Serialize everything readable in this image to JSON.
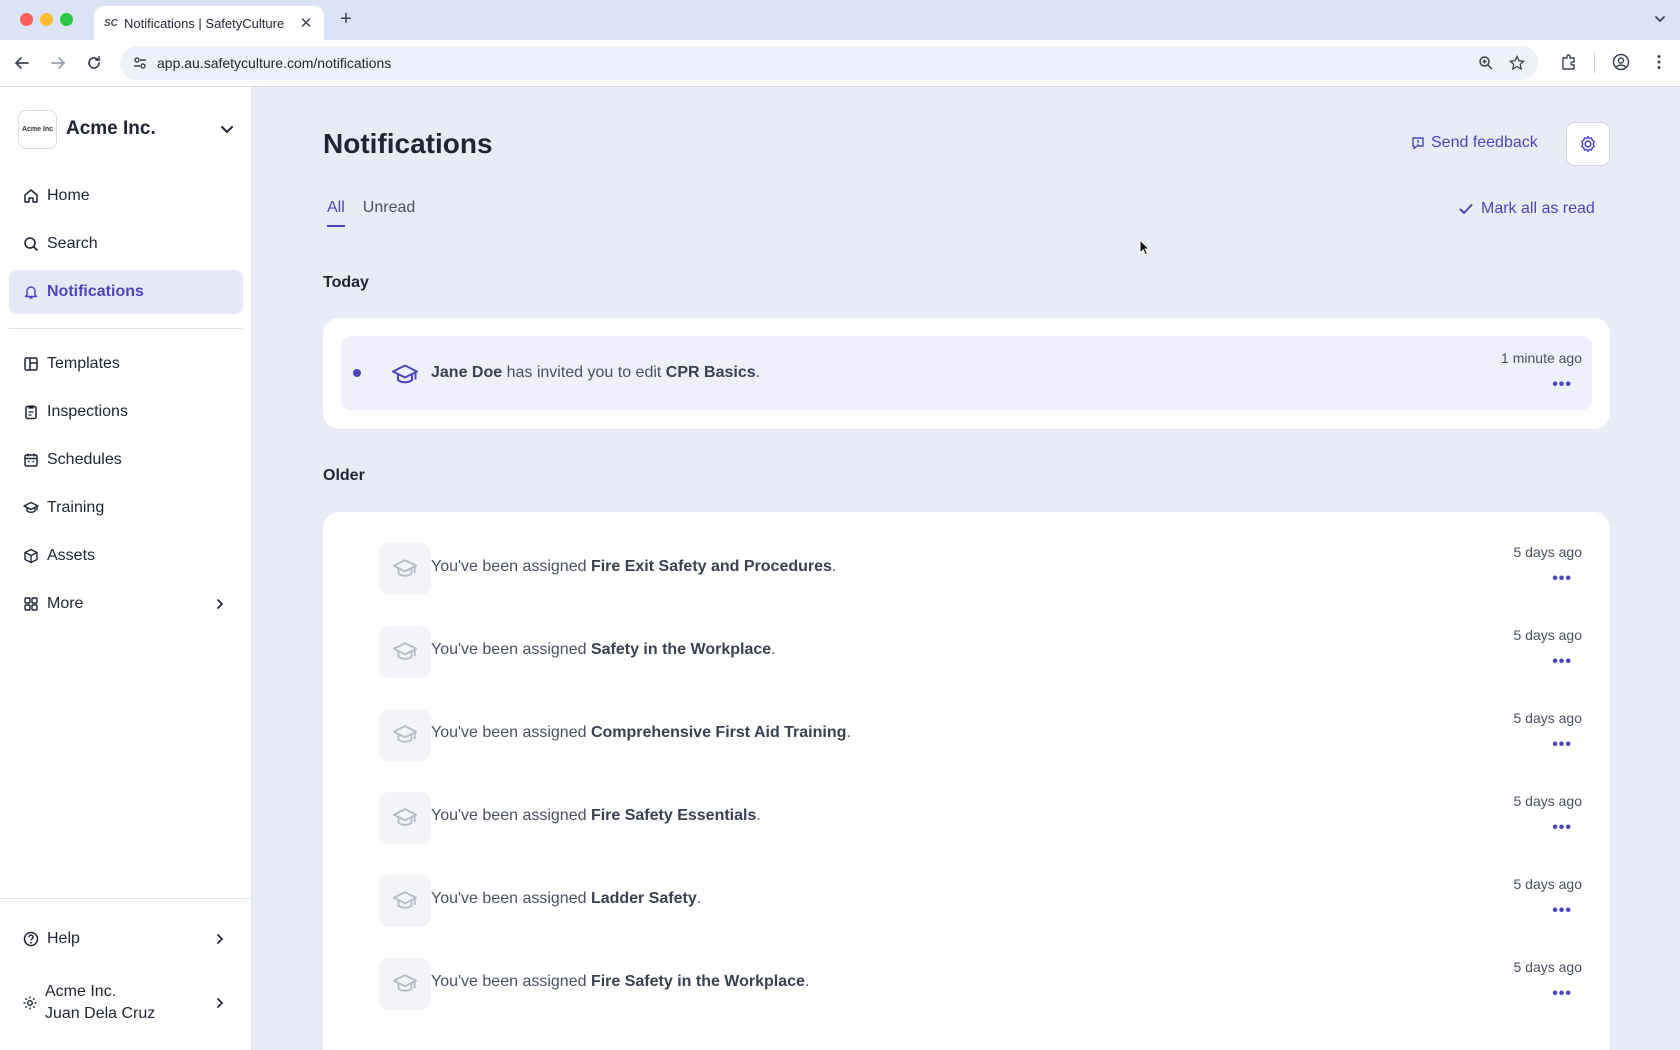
{
  "browser": {
    "tab_favicon": "SC",
    "tab_title": "Notifications | SafetyCulture",
    "tab_close": "✕",
    "new_tab": "+",
    "url": "app.au.safetyculture.com/notifications"
  },
  "sidebar": {
    "org_logo_text": "Acme Inc",
    "org_name": "Acme Inc.",
    "items": [
      {
        "label": "Home",
        "icon": "home-icon"
      },
      {
        "label": "Search",
        "icon": "search-icon"
      },
      {
        "label": "Notifications",
        "icon": "bell-icon",
        "active": true
      },
      {
        "label": "Templates",
        "icon": "templates-icon"
      },
      {
        "label": "Inspections",
        "icon": "clipboard-icon"
      },
      {
        "label": "Schedules",
        "icon": "calendar-icon"
      },
      {
        "label": "Training",
        "icon": "graduation-cap-icon"
      },
      {
        "label": "Assets",
        "icon": "box-icon"
      },
      {
        "label": "More",
        "icon": "grid-icon"
      }
    ],
    "help_label": "Help",
    "account_org": "Acme Inc.",
    "account_user": "Juan Dela Cruz"
  },
  "main": {
    "title": "Notifications",
    "send_feedback": "Send feedback",
    "tabs": [
      {
        "label": "All",
        "selected": true
      },
      {
        "label": "Unread"
      }
    ],
    "mark_all_read": "Mark all as read",
    "today_heading": "Today",
    "older_heading": "Older",
    "more_label": "•••",
    "today": [
      {
        "actor": "Jane Doe",
        "text": " has invited you to edit ",
        "item": "CPR Basics",
        "end": ".",
        "time": "1 minute ago",
        "unread": true
      }
    ],
    "older": [
      {
        "prefix": "You've been assigned ",
        "item": "Fire Exit Safety and Procedures",
        "end": ".",
        "time": "5 days ago"
      },
      {
        "prefix": "You've been assigned ",
        "item": "Safety in the Workplace",
        "end": ".",
        "time": "5 days ago"
      },
      {
        "prefix": "You've been assigned ",
        "item": "Comprehensive First Aid Training",
        "end": ".",
        "time": "5 days ago"
      },
      {
        "prefix": "You've been assigned ",
        "item": "Fire Safety Essentials",
        "end": ".",
        "time": "5 days ago"
      },
      {
        "prefix": "You've been assigned ",
        "item": "Ladder Safety",
        "end": ".",
        "time": "5 days ago"
      },
      {
        "prefix": "You've been assigned ",
        "item": "Fire Safety in the Workplace",
        "end": ".",
        "time": "5 days ago"
      }
    ]
  },
  "colors": {
    "accent": "#4b46bf",
    "page_bg": "#e9ecf6",
    "unread_bg": "#eff0fb"
  }
}
